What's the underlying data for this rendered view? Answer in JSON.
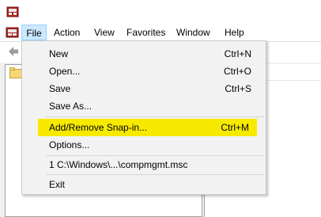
{
  "menubar": {
    "items": [
      {
        "key": "file",
        "label": "File"
      },
      {
        "key": "action",
        "label": "Action"
      },
      {
        "key": "view",
        "label": "View"
      },
      {
        "key": "favorites",
        "label": "Favorites"
      },
      {
        "key": "window",
        "label": "Window"
      },
      {
        "key": "help",
        "label": "Help"
      }
    ]
  },
  "file_menu": {
    "items": [
      {
        "label": "New",
        "shortcut": "Ctrl+N"
      },
      {
        "label": "Open...",
        "shortcut": "Ctrl+O"
      },
      {
        "label": "Save",
        "shortcut": "Ctrl+S"
      },
      {
        "label": "Save As...",
        "shortcut": ""
      },
      {
        "label": "Add/Remove Snap-in...",
        "shortcut": "Ctrl+M",
        "highlighted": true
      },
      {
        "label": "Options...",
        "shortcut": ""
      },
      {
        "label": "1 C:\\Windows\\...\\compmgmt.msc",
        "shortcut": ""
      },
      {
        "label": "Exit",
        "shortcut": ""
      }
    ]
  },
  "colors": {
    "highlight": "#f7ea00",
    "file_selected_bg": "#cce8ff",
    "menu_bg": "#f2f2f2"
  },
  "icons": [
    "mmc-app-icon",
    "mmc-document-icon",
    "back-arrow-icon",
    "folder-icon"
  ]
}
